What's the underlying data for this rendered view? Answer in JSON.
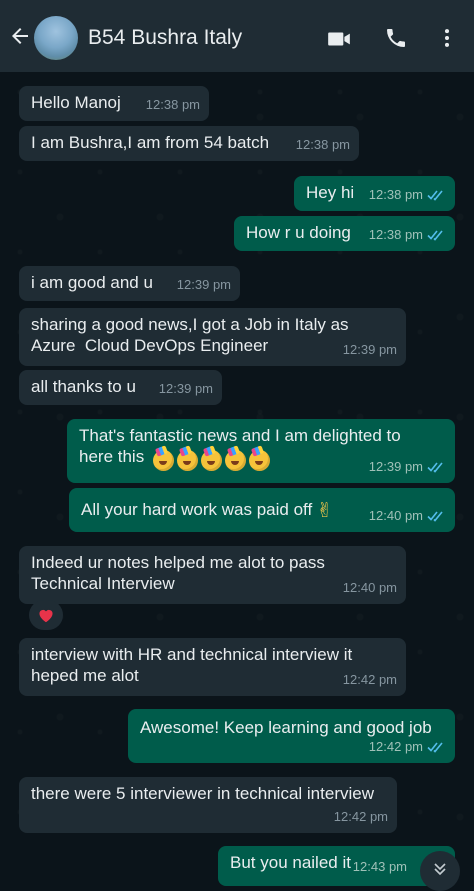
{
  "header": {
    "contact_name": "B54 Bushra Italy",
    "icons": [
      "back-arrow-icon",
      "video-call-icon",
      "voice-call-icon",
      "more-options-icon"
    ]
  },
  "colors": {
    "header_bg": "#1f2c34",
    "chat_bg": "#0b141a",
    "incoming_bubble": "#1f2c34",
    "outgoing_bubble": "#005c4b",
    "read_ticks": "#53bdeb"
  },
  "messages": [
    {
      "dir": "in",
      "text": "Hello Manoj",
      "time": "12:38 pm"
    },
    {
      "dir": "in",
      "text": "I am Bushra,I am from 54 batch",
      "time": "12:38 pm"
    },
    {
      "dir": "out",
      "text": "Hey hi",
      "time": "12:38 pm"
    },
    {
      "dir": "out",
      "text": "How r u doing",
      "time": "12:38 pm"
    },
    {
      "dir": "in",
      "text": "i am good and u",
      "time": "12:39 pm"
    },
    {
      "dir": "in",
      "text": "sharing a good news,I got a Job in Italy as\nAzure  Cloud DevOps Engineer",
      "time": "12:39 pm"
    },
    {
      "dir": "in",
      "text": "all thanks to u",
      "time": "12:39 pm"
    },
    {
      "dir": "out",
      "text": "That's fantastic news and I am delighted to\nhere this",
      "time": "12:39 pm"
    },
    {
      "dir": "out",
      "text": "All your hard work was paid off",
      "time": "12:40 pm"
    },
    {
      "dir": "in",
      "text": "Indeed ur notes helped me alot to pass\nTechnical Interview",
      "time": "12:40 pm"
    },
    {
      "dir": "in",
      "text": "interview with HR and technical interview it\nheped me alot",
      "time": "12:42 pm"
    },
    {
      "dir": "out",
      "text": "Awesome! Keep learning and good job",
      "time": "12:42 pm"
    },
    {
      "dir": "in",
      "text": "there were 5 interviewer in technical interview",
      "time": "12:42 pm"
    },
    {
      "dir": "out",
      "text": "But you nailed it",
      "time": "12:43 pm"
    }
  ]
}
